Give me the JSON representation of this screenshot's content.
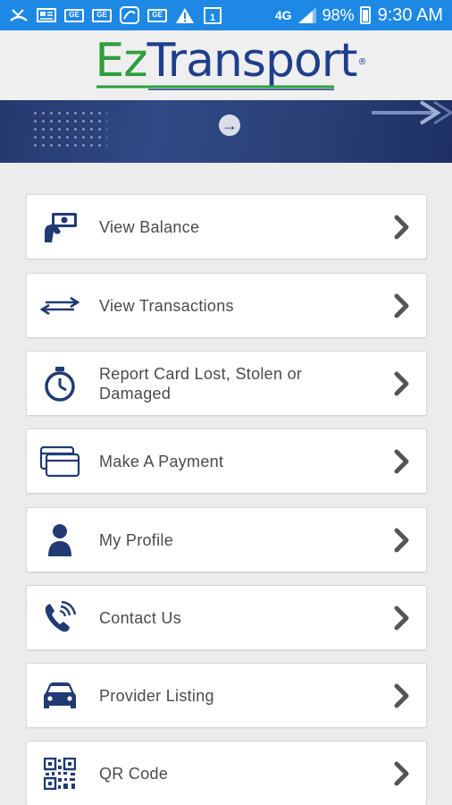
{
  "status_bar": {
    "battery_text": "98%",
    "network_text": "4G",
    "time": "9:30 AM",
    "icons": [
      "missed-call-icon",
      "news-icon",
      "ge-app-icon",
      "ge-app-icon",
      "sprint-icon",
      "ge-app-icon",
      "warning-icon",
      "calendar-icon"
    ]
  },
  "header": {
    "logo_part1": "Ez",
    "logo_part2": "Transport",
    "logo_mark": "®"
  },
  "colors": {
    "status_bar": "#1e88e5",
    "brand_green": "#2e9e3c",
    "brand_blue": "#1f3f8c",
    "icon_navy": "#213a73",
    "chevron_gray": "#555555"
  },
  "menu": {
    "items": [
      {
        "label": "View Balance",
        "icon": "money-hand-icon"
      },
      {
        "label": "View Transactions",
        "icon": "double-arrow-icon"
      },
      {
        "label": "Report Card Lost, Stolen or Damaged",
        "icon": "stopwatch-icon"
      },
      {
        "label": "Make A Payment",
        "icon": "cards-icon"
      },
      {
        "label": "My Profile",
        "icon": "person-icon"
      },
      {
        "label": "Contact Us",
        "icon": "phone-icon"
      },
      {
        "label": "Provider Listing",
        "icon": "car-icon"
      },
      {
        "label": "QR Code",
        "icon": "qr-code-icon"
      }
    ]
  }
}
